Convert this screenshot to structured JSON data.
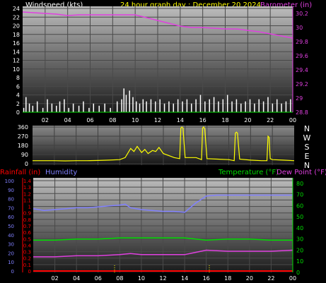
{
  "header": {
    "windspeed_label": "Windspeed (kts)",
    "title": "24 hour graph day : December 20 2024",
    "barometer_label": "Barometer (in)"
  },
  "mid_header": {
    "rainfall_label": "Rainfall (in)",
    "humidity_label": "Humidity",
    "temperature_label": "Temperature (°F)",
    "dewpoint_label": "Dew Point (°F)"
  },
  "colors": {
    "wind": "#ffffff",
    "barometer": "#e040e0",
    "direction": "#ffff00",
    "humidity": "#8080ff",
    "temperature": "#00dd00",
    "dewpoint": "#e040e0",
    "rainfall": "#ff0000",
    "title": "#ffff00"
  },
  "chart_data": [
    {
      "name": "wind_barometer",
      "type": "line",
      "x_ticks": [
        "02",
        "04",
        "06",
        "08",
        "10",
        "12",
        "14",
        "16",
        "18",
        "20",
        "22",
        "00"
      ],
      "y_left_ticks": [
        "0",
        "2",
        "4",
        "6",
        "8",
        "10",
        "12",
        "14",
        "16",
        "18",
        "20",
        "22",
        "24"
      ],
      "y_left_range": [
        0,
        24.5
      ],
      "y_right_ticks": [
        "28.8",
        "29",
        "29.2",
        "29.4",
        "29.6",
        "29.8",
        "30",
        "30.2"
      ],
      "y_right_range": [
        28.8,
        30.3
      ],
      "barometer": {
        "x": [
          0,
          1,
          2,
          3,
          4,
          5,
          6,
          7,
          8,
          9,
          10,
          11,
          12,
          13,
          14,
          15,
          16,
          17,
          18,
          19,
          20,
          21,
          22,
          23,
          24
        ],
        "y": [
          30.22,
          30.21,
          30.2,
          30.19,
          30.17,
          30.18,
          30.18,
          30.18,
          30.18,
          30.18,
          30.18,
          30.14,
          30.1,
          30.06,
          30.02,
          30.0,
          30.0,
          29.99,
          29.98,
          29.98,
          29.96,
          29.94,
          29.91,
          29.88,
          29.85
        ]
      },
      "wind_bars": [
        {
          "x": 0.1,
          "v": 1
        },
        {
          "x": 0.3,
          "v": 3.5
        },
        {
          "x": 0.6,
          "v": 2
        },
        {
          "x": 0.9,
          "v": 1.5
        },
        {
          "x": 1.3,
          "v": 2.5
        },
        {
          "x": 1.8,
          "v": 1
        },
        {
          "x": 2.2,
          "v": 3
        },
        {
          "x": 2.6,
          "v": 2
        },
        {
          "x": 3.0,
          "v": 1.5
        },
        {
          "x": 3.3,
          "v": 2.5
        },
        {
          "x": 3.7,
          "v": 3
        },
        {
          "x": 4.1,
          "v": 1
        },
        {
          "x": 4.5,
          "v": 2
        },
        {
          "x": 5.0,
          "v": 1.5
        },
        {
          "x": 5.4,
          "v": 2.5
        },
        {
          "x": 5.9,
          "v": 1
        },
        {
          "x": 6.3,
          "v": 2
        },
        {
          "x": 6.8,
          "v": 1.5
        },
        {
          "x": 7.3,
          "v": 2
        },
        {
          "x": 7.8,
          "v": 1
        },
        {
          "x": 8.4,
          "v": 2.5
        },
        {
          "x": 8.8,
          "v": 3
        },
        {
          "x": 9.0,
          "v": 5.5
        },
        {
          "x": 9.2,
          "v": 4
        },
        {
          "x": 9.5,
          "v": 5
        },
        {
          "x": 9.8,
          "v": 3.5
        },
        {
          "x": 10.1,
          "v": 2.5
        },
        {
          "x": 10.4,
          "v": 2
        },
        {
          "x": 10.7,
          "v": 3
        },
        {
          "x": 11.0,
          "v": 2.5
        },
        {
          "x": 11.4,
          "v": 3
        },
        {
          "x": 11.8,
          "v": 2.5
        },
        {
          "x": 12.2,
          "v": 3
        },
        {
          "x": 12.6,
          "v": 2
        },
        {
          "x": 13.0,
          "v": 2.5
        },
        {
          "x": 13.4,
          "v": 2
        },
        {
          "x": 13.8,
          "v": 3
        },
        {
          "x": 14.2,
          "v": 2.5
        },
        {
          "x": 14.6,
          "v": 3
        },
        {
          "x": 15.0,
          "v": 2
        },
        {
          "x": 15.4,
          "v": 3
        },
        {
          "x": 15.8,
          "v": 4
        },
        {
          "x": 16.2,
          "v": 2.5
        },
        {
          "x": 16.6,
          "v": 3
        },
        {
          "x": 17.0,
          "v": 3.5
        },
        {
          "x": 17.4,
          "v": 2.5
        },
        {
          "x": 17.8,
          "v": 3
        },
        {
          "x": 18.2,
          "v": 4
        },
        {
          "x": 18.6,
          "v": 2.5
        },
        {
          "x": 19.0,
          "v": 3
        },
        {
          "x": 19.4,
          "v": 2
        },
        {
          "x": 19.8,
          "v": 2.5
        },
        {
          "x": 20.2,
          "v": 3
        },
        {
          "x": 20.6,
          "v": 2
        },
        {
          "x": 21.0,
          "v": 3
        },
        {
          "x": 21.4,
          "v": 2.5
        },
        {
          "x": 21.8,
          "v": 3.5
        },
        {
          "x": 22.2,
          "v": 2
        },
        {
          "x": 22.6,
          "v": 3
        },
        {
          "x": 23.0,
          "v": 2
        },
        {
          "x": 23.4,
          "v": 2.5
        },
        {
          "x": 23.8,
          "v": 3
        }
      ]
    },
    {
      "name": "wind_direction",
      "type": "line",
      "y_left_ticks": [
        "0",
        "90",
        "180",
        "270",
        "360"
      ],
      "y_range": [
        0,
        360
      ],
      "compass_labels": [
        "N",
        "W",
        "S",
        "E",
        "N"
      ],
      "x": [
        0,
        1,
        2,
        3,
        4,
        5,
        6,
        7,
        8,
        8.5,
        9.0,
        9.3,
        9.6,
        10.0,
        10.3,
        10.6,
        11.0,
        11.3,
        11.6,
        12.0,
        12.5,
        13.0,
        13.5,
        13.6,
        13.7,
        13.8,
        14.0,
        15,
        15.5,
        15.6,
        15.7,
        15.8,
        16,
        17,
        18,
        18.5,
        18.6,
        18.7,
        18.8,
        19,
        20,
        21,
        21.5,
        21.6,
        21.7,
        21.8,
        22,
        23,
        24
      ],
      "y": [
        30,
        30,
        30,
        28,
        30,
        30,
        32,
        35,
        40,
        60,
        150,
        120,
        170,
        110,
        140,
        100,
        130,
        120,
        160,
        100,
        80,
        60,
        50,
        350,
        360,
        350,
        60,
        60,
        40,
        350,
        360,
        340,
        50,
        45,
        40,
        30,
        300,
        310,
        300,
        45,
        35,
        30,
        30,
        270,
        260,
        50,
        40,
        35,
        30
      ]
    },
    {
      "name": "temperature_humidity",
      "type": "line",
      "x_ticks": [
        "02",
        "04",
        "06",
        "08",
        "10",
        "12",
        "14",
        "16",
        "18",
        "20",
        "22",
        "00"
      ],
      "y_left_humidity_ticks": [
        "0",
        "10",
        "20",
        "30",
        "40",
        "50",
        "60",
        "70",
        "80",
        "90",
        "100"
      ],
      "y_left_rain_ticks": [
        "0",
        "0.1",
        "0.2",
        "0.3",
        "0.4",
        "0.5",
        "0.6",
        "0.7",
        "0.8",
        "0.9",
        "1",
        "1.1",
        "1.2",
        "1.3",
        "1.4"
      ],
      "y_right_ticks": [
        "0",
        "10",
        "20",
        "30",
        "40",
        "50",
        "60",
        "70",
        "80"
      ],
      "y_right_range": [
        0,
        85
      ],
      "humidity": {
        "x": [
          0,
          1,
          2,
          3,
          4,
          5,
          6,
          7,
          8,
          8.5,
          9,
          10,
          11,
          12,
          13,
          14,
          15,
          16,
          17,
          18,
          19,
          20,
          21,
          22,
          23,
          24
        ],
        "y": [
          69,
          67,
          68,
          69,
          70,
          70,
          71,
          72,
          73,
          74,
          70,
          68,
          67,
          66,
          66,
          65,
          75,
          83,
          84,
          84,
          84,
          84,
          84,
          84,
          84,
          84
        ]
      },
      "temperature": {
        "x": [
          0,
          2,
          4,
          6,
          8,
          10,
          12,
          14,
          16,
          18,
          20,
          22,
          24
        ],
        "y": [
          29,
          29,
          30,
          30,
          31,
          31,
          31,
          31,
          29,
          30,
          30,
          29,
          29
        ]
      },
      "dewpoint": {
        "x": [
          0,
          2,
          4,
          6,
          8,
          9,
          10,
          12,
          14,
          15,
          16,
          18,
          20,
          22,
          24
        ],
        "y": [
          14,
          14,
          15,
          15,
          16,
          17,
          16,
          16,
          16,
          18,
          20,
          19,
          19,
          19,
          20
        ]
      },
      "rainfall": {
        "x": [
          0,
          24
        ],
        "y": [
          0,
          0
        ]
      }
    }
  ]
}
